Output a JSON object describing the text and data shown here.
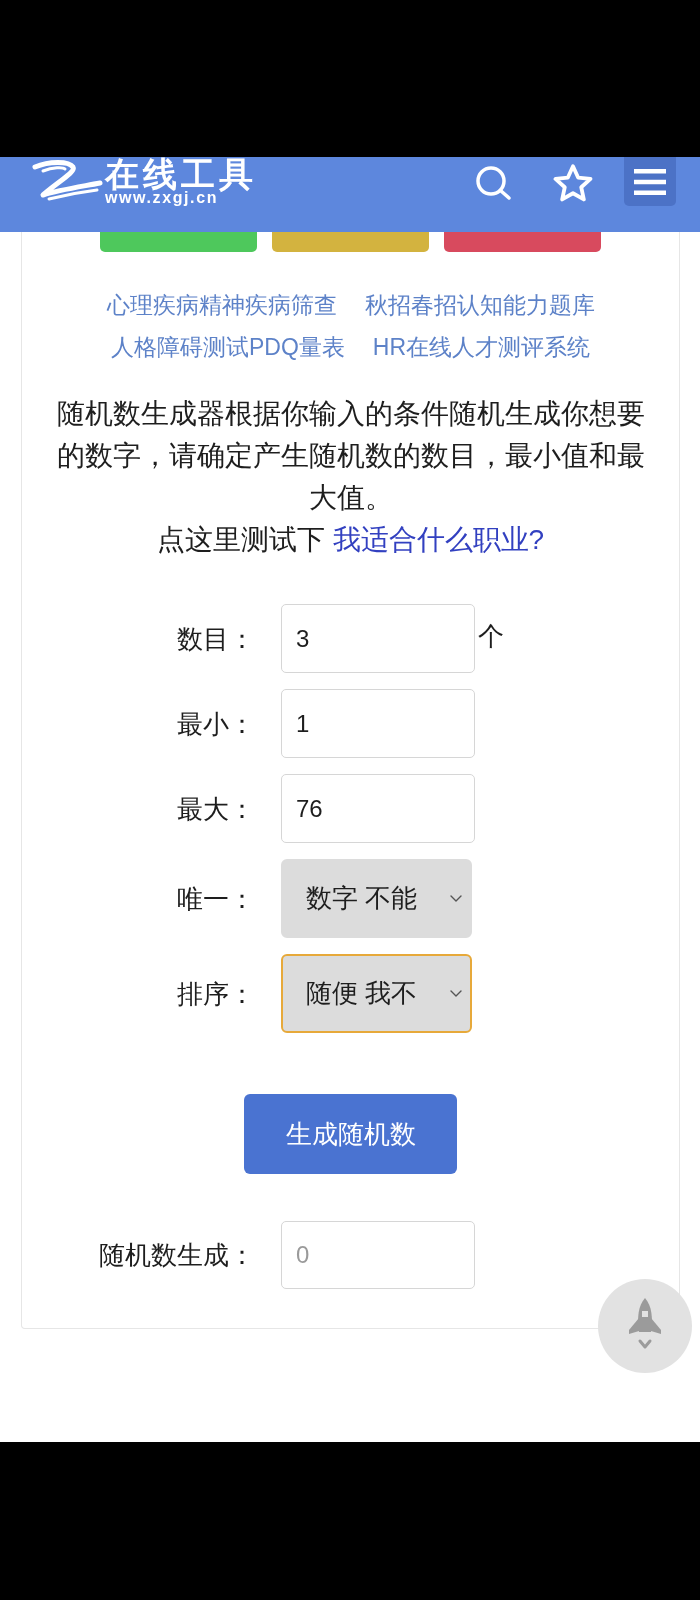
{
  "header": {
    "logo_title": "在线工具",
    "logo_url": "www.zxgj.cn"
  },
  "top_buttons": [
    {
      "color": "#4ec85c"
    },
    {
      "color": "#d3b33f"
    },
    {
      "color": "#d84a5e"
    }
  ],
  "link_rows": [
    {
      "links": [
        "心理疾病精神疾病筛查",
        "秋招春招认知能力题库"
      ]
    },
    {
      "links": [
        "人格障碍测试PDQ量表",
        "HR在线人才测评系统"
      ]
    }
  ],
  "intro": {
    "text": "随机数生成器根据你输入的条件随机生成你想要的数字，请确定产生随机数的数目，最小值和最大值。",
    "prompt": "点这里测试下",
    "link": "我适合什么职业?"
  },
  "form": {
    "fields": [
      {
        "kind": "input",
        "label": "数目：",
        "value": "3",
        "unit": "个"
      },
      {
        "kind": "input",
        "label": "最小：",
        "value": "1"
      },
      {
        "kind": "input",
        "label": "最大：",
        "value": "76"
      },
      {
        "kind": "select",
        "label": "唯一：",
        "value": "数字 不能",
        "focused": false
      },
      {
        "kind": "select",
        "label": "排序：",
        "value": "随便 我不",
        "focused": true
      }
    ],
    "submit": "生成随机数",
    "result": {
      "label": "随机数生成：",
      "placeholder": "0"
    }
  }
}
